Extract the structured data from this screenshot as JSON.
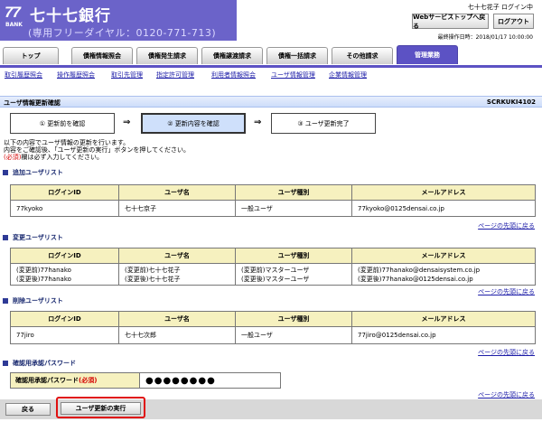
{
  "header": {
    "logo_number": "77",
    "logo_bank": "BANK",
    "bank_name": "七十七銀行",
    "free_dial": "(専用フリーダイヤル：0120-771-713)",
    "user_info": "七十七花子 ログイン中",
    "web_service_top_button": "Webサービストップへ戻る",
    "logout_button": "ログアウト",
    "last_login": "最終操作日時：2018/01/17 10:00:00"
  },
  "tabs": [
    {
      "label": "トップ"
    },
    {
      "label": "債権情報照会"
    },
    {
      "label": "債権発生請求"
    },
    {
      "label": "債権譲渡請求"
    },
    {
      "label": "債権一括請求"
    },
    {
      "label": "その他請求"
    },
    {
      "label": "管理業務"
    }
  ],
  "subnav": [
    {
      "label": "取引履歴照会"
    },
    {
      "label": "操作履歴照会"
    },
    {
      "label": "取引先管理"
    },
    {
      "label": "指定許可管理"
    },
    {
      "label": "利用者情報照会"
    },
    {
      "label": "ユーザ情報管理"
    },
    {
      "label": "企業情報管理"
    }
  ],
  "page": {
    "title": "ユーザ情報更新確認",
    "screen_code": "SCRKUKI4102"
  },
  "steps": [
    {
      "label": "① 更新前を確認"
    },
    {
      "label": "② 更新内容を確認"
    },
    {
      "label": "③ ユーザ更新完了"
    }
  ],
  "step_arrow": "⇒",
  "intro": {
    "line1": "以下の内容でユーザ情報の更新を行います。",
    "line2": "内容をご確認後、「ユーザ更新の実行」ボタンを押してください。",
    "required_mark": "(必須)",
    "line3_rest": "欄は必ず入力してください。"
  },
  "columns": {
    "login_id": "ログインID",
    "user_name": "ユーザ名",
    "user_type": "ユーザ種別",
    "email": "メールアドレス"
  },
  "sections": {
    "add": {
      "title": "追加ユーザリスト",
      "rows": [
        {
          "login_id": "77kyoko",
          "user_name": "七十七京子",
          "user_type": "一般ユーザ",
          "email": "77kyoko@0125densai.co.jp"
        }
      ]
    },
    "change": {
      "title": "変更ユーザリスト",
      "rows": [
        {
          "login_id_1": "(変更前)77hanako",
          "login_id_2": "(変更後)77hanako",
          "user_name_1": "(変更前)七十七花子",
          "user_name_2": "(変更後)七十七花子",
          "user_type_1": "(変更前)マスターユーザ",
          "user_type_2": "(変更後)マスターユーザ",
          "email_1": "(変更前)77hanako@densaisystem.co.jp",
          "email_2": "(変更後)77hanako@0125densai.co.jp"
        }
      ]
    },
    "delete": {
      "title": "削除ユーザリスト",
      "rows": [
        {
          "login_id": "77jiro",
          "user_name": "七十七次郎",
          "user_type": "一般ユーザ",
          "email": "77jiro@0125densai.co.jp"
        }
      ]
    },
    "password": {
      "title": "確認用承認パスワード",
      "label": "確認用承認パスワード",
      "required": "(必須)",
      "value": "●●●●●●●●"
    }
  },
  "page_top_link": "ページの先頭に戻る",
  "buttons": {
    "back": "戻る",
    "execute": "ユーザ更新の実行"
  }
}
